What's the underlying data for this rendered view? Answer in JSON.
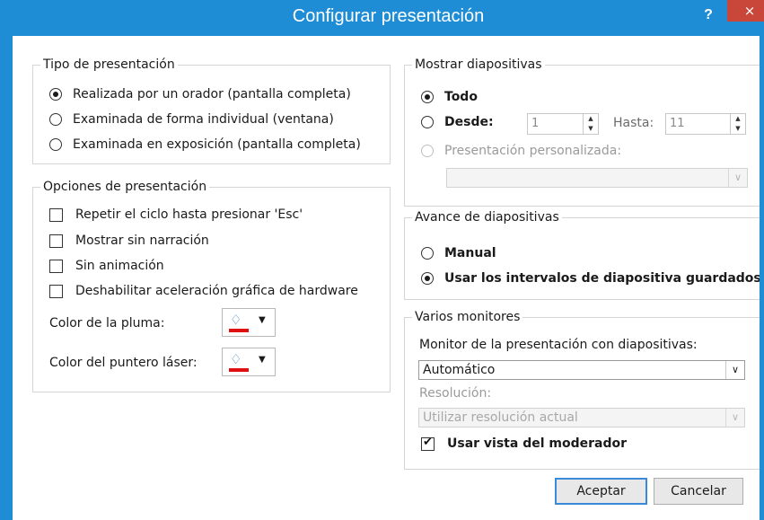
{
  "dialog": {
    "title": "Configurar presentación",
    "help_label": "?",
    "close_label": "×"
  },
  "tipo": {
    "legend": "Tipo de presentación",
    "options": [
      {
        "label": "Realizada por un orador (pantalla completa)",
        "checked": true
      },
      {
        "label": "Examinada de forma individual (ventana)",
        "checked": false
      },
      {
        "label": "Examinada en exposición (pantalla completa)",
        "checked": false
      }
    ]
  },
  "opciones": {
    "legend": "Opciones de presentación",
    "checks": [
      {
        "label": "Repetir el ciclo hasta presionar 'Esc'",
        "checked": false
      },
      {
        "label": "Mostrar sin narración",
        "checked": false
      },
      {
        "label": "Sin animación",
        "checked": false
      },
      {
        "label": "Deshabilitar aceleración gráfica de hardware",
        "checked": false
      }
    ],
    "pen_color_label": "Color de la pluma:",
    "laser_color_label": "Color del puntero láser:",
    "pen_color": "#e01010",
    "laser_color": "#e01010",
    "color_icon": "paint-bucket-icon"
  },
  "mostrar": {
    "legend": "Mostrar diapositivas",
    "todo_label": "Todo",
    "desde_label": "Desde:",
    "desde_value": "1",
    "hasta_label": "Hasta:",
    "hasta_value": "11",
    "personalizada_label": "Presentación personalizada:",
    "personalizada_value": ""
  },
  "avance": {
    "legend": "Avance de diapositivas",
    "manual_label": "Manual",
    "intervalos_label": "Usar los intervalos de diapositiva guardados"
  },
  "monitores": {
    "legend": "Varios monitores",
    "monitor_label": "Monitor de la presentación con diapositivas:",
    "monitor_value": "Automático",
    "resolucion_label": "Resolución:",
    "resolucion_value": "Utilizar resolución actual",
    "moderador_label": "Usar vista del moderador",
    "moderador_checked": true
  },
  "buttons": {
    "ok": "Aceptar",
    "cancel": "Cancelar"
  },
  "colors": {
    "accent": "#1f8dd6",
    "close": "#c9473a"
  }
}
